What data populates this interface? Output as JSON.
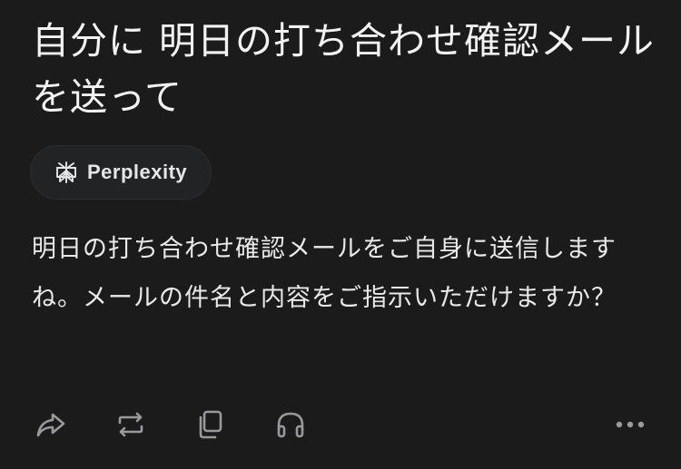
{
  "query": {
    "title": "自分に 明日の打ち合わせ確認メールを送って"
  },
  "source": {
    "label": "Perplexity",
    "icon": "perplexity-logo-icon"
  },
  "answer": {
    "text": "明日の打ち合わせ確認メールをご自身に送信しますね。メールの件名と内容をご指示いただけますか？"
  },
  "actions": [
    {
      "icon": "share-icon"
    },
    {
      "icon": "rewrite-icon"
    },
    {
      "icon": "copy-icon"
    },
    {
      "icon": "headphones-icon"
    },
    {
      "icon": "more-options-icon"
    }
  ],
  "colors": {
    "background": "#1b1b1c",
    "text": "#ececec",
    "chip_background": "#222324",
    "icon": "#9a9a9c"
  }
}
